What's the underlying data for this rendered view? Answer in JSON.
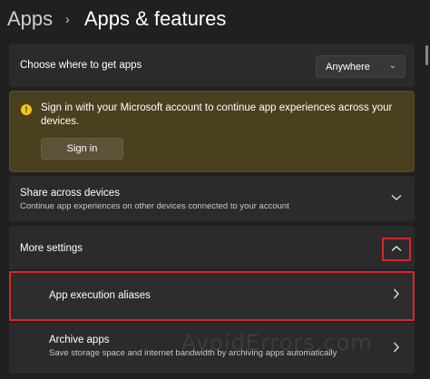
{
  "breadcrumb": {
    "parent": "Apps",
    "separator": "›",
    "current": "Apps & features"
  },
  "choose_source": {
    "label": "Choose where to get apps",
    "dropdown_value": "Anywhere"
  },
  "signin_banner": {
    "icon": "info-icon",
    "icon_glyph": "!",
    "message": "Sign in with your Microsoft account to continue app experiences across your devices.",
    "button_label": "Sign in",
    "background_color": "#4a3f1e",
    "icon_color": "#f5c518"
  },
  "share": {
    "title": "Share across devices",
    "description": "Continue app experiences on other devices connected to your account"
  },
  "more_settings": {
    "title": "More settings",
    "expanded": true,
    "items": [
      {
        "title": "App execution aliases",
        "description": ""
      },
      {
        "title": "Archive apps",
        "description": "Save storage space and internet bandwidth by archiving apps automatically"
      }
    ]
  },
  "highlight_color": "#d9262b",
  "watermark": "AvoidErrors.com"
}
